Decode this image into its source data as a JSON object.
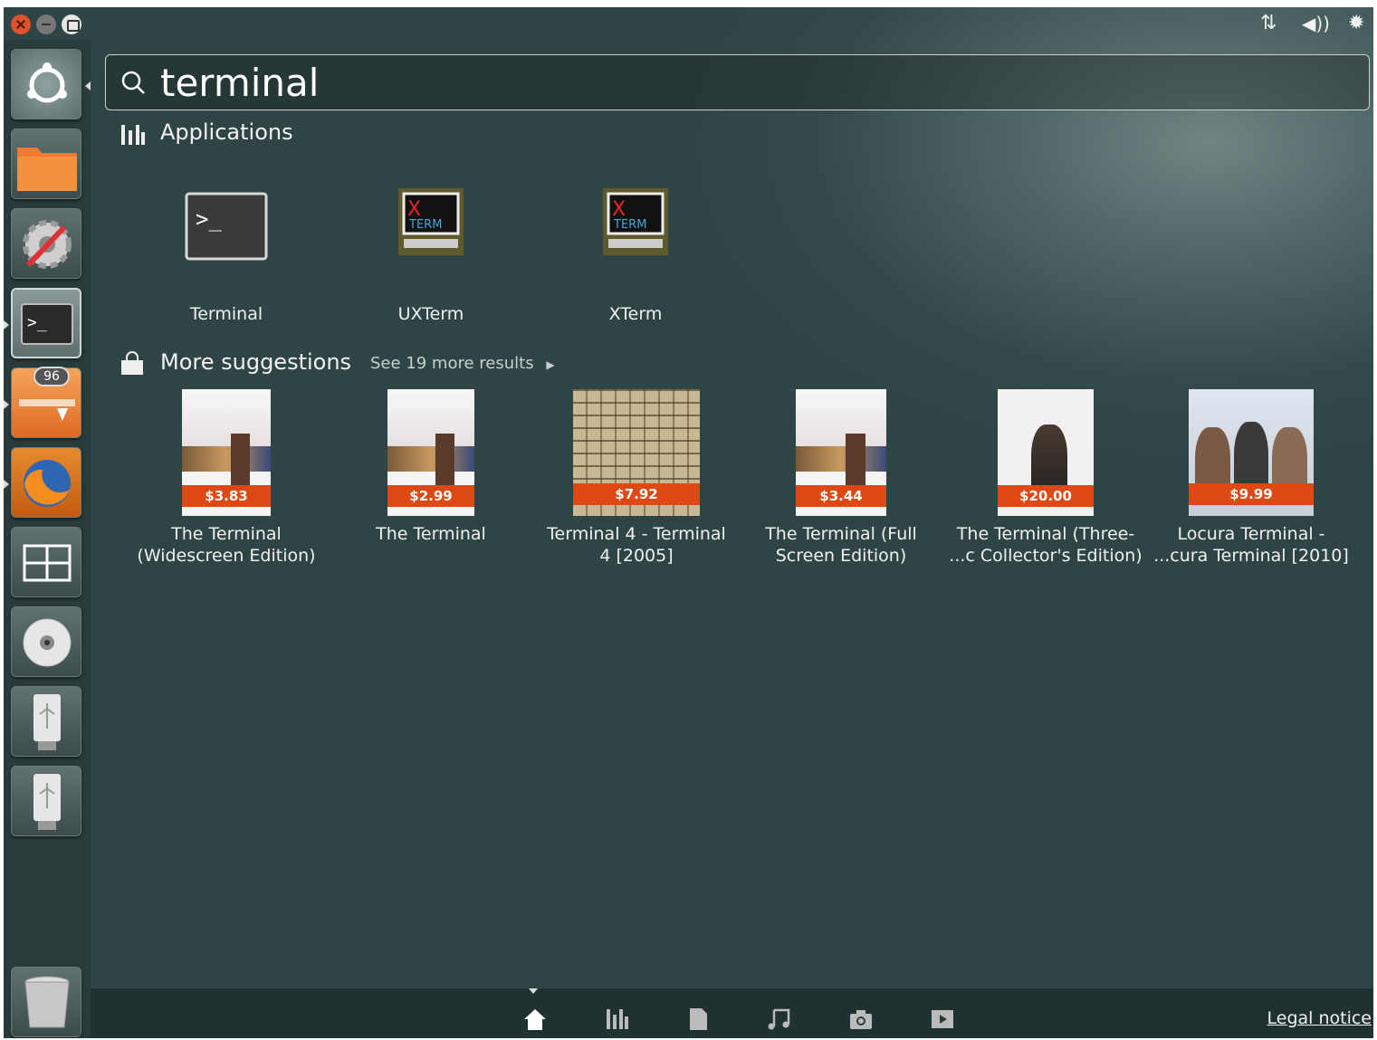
{
  "search": {
    "query": "terminal"
  },
  "applications": {
    "title": "Applications",
    "items": [
      {
        "label": "Terminal"
      },
      {
        "label": "UXTerm"
      },
      {
        "label": "XTerm"
      }
    ]
  },
  "suggestions": {
    "title": "More suggestions",
    "more_link": "See 19 more results",
    "items": [
      {
        "price": "$3.83",
        "line1": "The Terminal",
        "line2": "(Widescreen Edition)"
      },
      {
        "price": "$2.99",
        "line1": "The Terminal",
        "line2": ""
      },
      {
        "price": "$7.92",
        "line1": "Terminal 4 - Terminal",
        "line2": "4 [2005]"
      },
      {
        "price": "$3.44",
        "line1": "The Terminal (Full",
        "line2": "Screen Edition)"
      },
      {
        "price": "$20.00",
        "line1": "The Terminal (Three-",
        "line2": "...c Collector's Edition)"
      },
      {
        "price": "$9.99",
        "line1": "Locura Terminal -",
        "line2": "...cura Terminal [2010]"
      }
    ]
  },
  "launcher": {
    "badge": "96"
  },
  "footer": {
    "legal": "Legal notice"
  },
  "colors": {
    "accent": "#dd4814",
    "background": "#2f4545"
  }
}
